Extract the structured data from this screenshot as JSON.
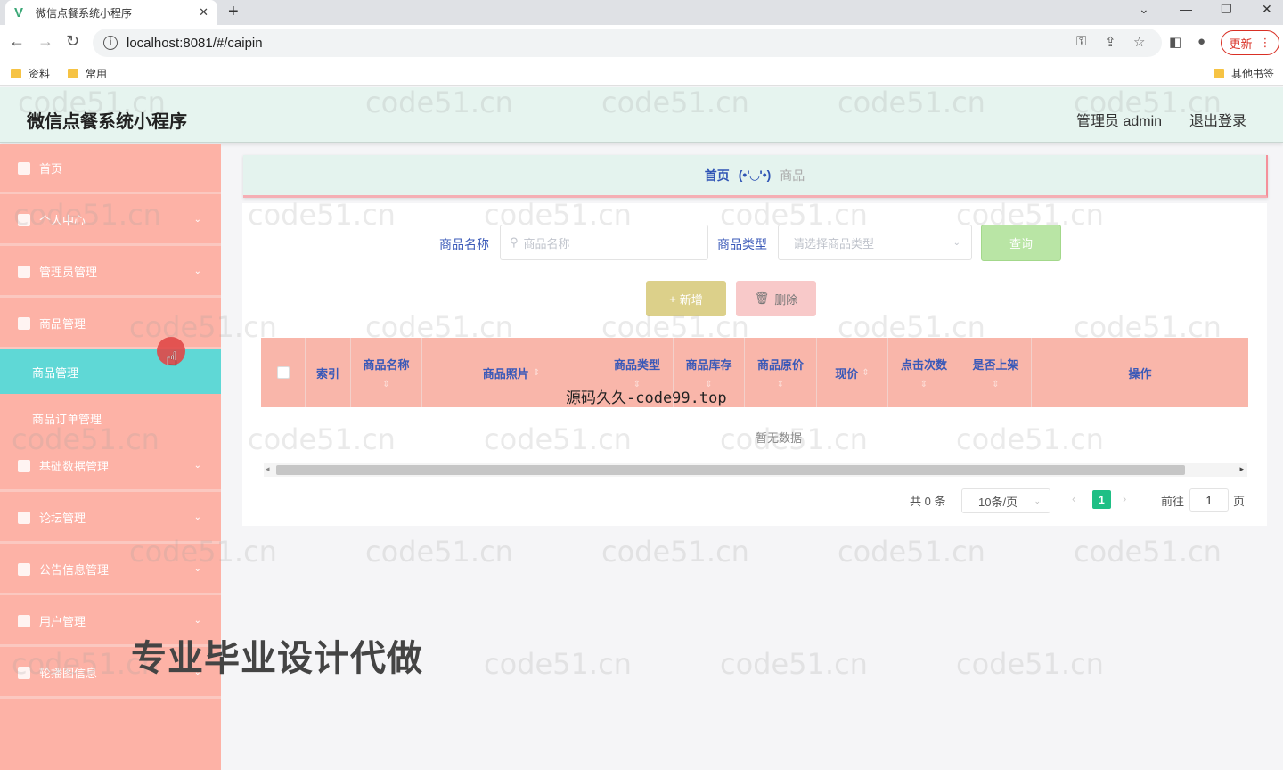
{
  "browser": {
    "tab_title": "微信点餐系统小程序",
    "url": "localhost:8081/#/caipin",
    "update_label": "更新",
    "bookmarks": [
      "资料",
      "常用"
    ],
    "other_bookmarks": "其他书签"
  },
  "header": {
    "app_title": "微信点餐系统小程序",
    "admin_label": "管理员 admin",
    "logout_label": "退出登录"
  },
  "sidebar": {
    "items": [
      {
        "label": "首页"
      },
      {
        "label": "个人中心"
      },
      {
        "label": "管理员管理"
      },
      {
        "label": "商品管理"
      },
      {
        "label": "基础数据管理"
      },
      {
        "label": "论坛管理"
      },
      {
        "label": "公告信息管理"
      },
      {
        "label": "用户管理"
      },
      {
        "label": "轮播图信息"
      }
    ],
    "subitems": [
      {
        "label": "商品管理"
      },
      {
        "label": "商品订单管理"
      }
    ]
  },
  "breadcrumb": {
    "home": "首页",
    "separator": "(•'◡'•)",
    "current": "商品"
  },
  "search": {
    "name_label": "商品名称",
    "name_placeholder": "商品名称",
    "type_label": "商品类型",
    "type_placeholder": "请选择商品类型",
    "search_button": "查询"
  },
  "actions": {
    "add_label": "新增",
    "delete_label": "删除"
  },
  "table": {
    "columns": [
      "索引",
      "商品名称",
      "商品照片",
      "商品类型",
      "商品库存",
      "商品原价",
      "现价",
      "点击次数",
      "是否上架",
      "操作"
    ],
    "empty_text": "暂无数据"
  },
  "pagination": {
    "total": "共 0 条",
    "page_size": "10条/页",
    "current_page": "1",
    "goto_label": "前往",
    "goto_value": "1",
    "page_unit": "页"
  },
  "watermarks": {
    "site": "code51.cn",
    "overlay_code": "源码久久-code99.top",
    "overlay_ad": "专业毕业设计代做"
  }
}
